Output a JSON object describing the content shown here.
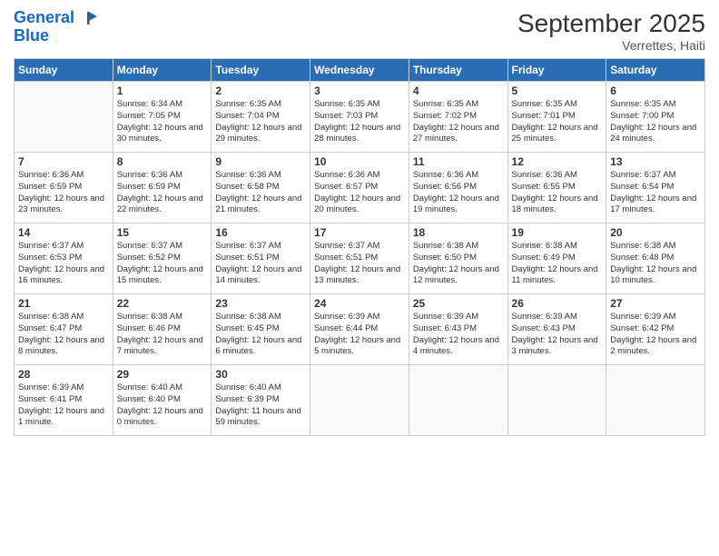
{
  "header": {
    "logo_line1": "General",
    "logo_line2": "Blue",
    "month_title": "September 2025",
    "subtitle": "Verrettes, Haiti"
  },
  "days_of_week": [
    "Sunday",
    "Monday",
    "Tuesday",
    "Wednesday",
    "Thursday",
    "Friday",
    "Saturday"
  ],
  "weeks": [
    [
      {
        "day": "",
        "empty": true
      },
      {
        "day": "1",
        "sunrise": "Sunrise: 6:34 AM",
        "sunset": "Sunset: 7:05 PM",
        "daylight": "Daylight: 12 hours and 30 minutes."
      },
      {
        "day": "2",
        "sunrise": "Sunrise: 6:35 AM",
        "sunset": "Sunset: 7:04 PM",
        "daylight": "Daylight: 12 hours and 29 minutes."
      },
      {
        "day": "3",
        "sunrise": "Sunrise: 6:35 AM",
        "sunset": "Sunset: 7:03 PM",
        "daylight": "Daylight: 12 hours and 28 minutes."
      },
      {
        "day": "4",
        "sunrise": "Sunrise: 6:35 AM",
        "sunset": "Sunset: 7:02 PM",
        "daylight": "Daylight: 12 hours and 27 minutes."
      },
      {
        "day": "5",
        "sunrise": "Sunrise: 6:35 AM",
        "sunset": "Sunset: 7:01 PM",
        "daylight": "Daylight: 12 hours and 25 minutes."
      },
      {
        "day": "6",
        "sunrise": "Sunrise: 6:35 AM",
        "sunset": "Sunset: 7:00 PM",
        "daylight": "Daylight: 12 hours and 24 minutes."
      }
    ],
    [
      {
        "day": "7",
        "sunrise": "Sunrise: 6:36 AM",
        "sunset": "Sunset: 6:59 PM",
        "daylight": "Daylight: 12 hours and 23 minutes."
      },
      {
        "day": "8",
        "sunrise": "Sunrise: 6:36 AM",
        "sunset": "Sunset: 6:59 PM",
        "daylight": "Daylight: 12 hours and 22 minutes."
      },
      {
        "day": "9",
        "sunrise": "Sunrise: 6:36 AM",
        "sunset": "Sunset: 6:58 PM",
        "daylight": "Daylight: 12 hours and 21 minutes."
      },
      {
        "day": "10",
        "sunrise": "Sunrise: 6:36 AM",
        "sunset": "Sunset: 6:57 PM",
        "daylight": "Daylight: 12 hours and 20 minutes."
      },
      {
        "day": "11",
        "sunrise": "Sunrise: 6:36 AM",
        "sunset": "Sunset: 6:56 PM",
        "daylight": "Daylight: 12 hours and 19 minutes."
      },
      {
        "day": "12",
        "sunrise": "Sunrise: 6:36 AM",
        "sunset": "Sunset: 6:55 PM",
        "daylight": "Daylight: 12 hours and 18 minutes."
      },
      {
        "day": "13",
        "sunrise": "Sunrise: 6:37 AM",
        "sunset": "Sunset: 6:54 PM",
        "daylight": "Daylight: 12 hours and 17 minutes."
      }
    ],
    [
      {
        "day": "14",
        "sunrise": "Sunrise: 6:37 AM",
        "sunset": "Sunset: 6:53 PM",
        "daylight": "Daylight: 12 hours and 16 minutes."
      },
      {
        "day": "15",
        "sunrise": "Sunrise: 6:37 AM",
        "sunset": "Sunset: 6:52 PM",
        "daylight": "Daylight: 12 hours and 15 minutes."
      },
      {
        "day": "16",
        "sunrise": "Sunrise: 6:37 AM",
        "sunset": "Sunset: 6:51 PM",
        "daylight": "Daylight: 12 hours and 14 minutes."
      },
      {
        "day": "17",
        "sunrise": "Sunrise: 6:37 AM",
        "sunset": "Sunset: 6:51 PM",
        "daylight": "Daylight: 12 hours and 13 minutes."
      },
      {
        "day": "18",
        "sunrise": "Sunrise: 6:38 AM",
        "sunset": "Sunset: 6:50 PM",
        "daylight": "Daylight: 12 hours and 12 minutes."
      },
      {
        "day": "19",
        "sunrise": "Sunrise: 6:38 AM",
        "sunset": "Sunset: 6:49 PM",
        "daylight": "Daylight: 12 hours and 11 minutes."
      },
      {
        "day": "20",
        "sunrise": "Sunrise: 6:38 AM",
        "sunset": "Sunset: 6:48 PM",
        "daylight": "Daylight: 12 hours and 10 minutes."
      }
    ],
    [
      {
        "day": "21",
        "sunrise": "Sunrise: 6:38 AM",
        "sunset": "Sunset: 6:47 PM",
        "daylight": "Daylight: 12 hours and 8 minutes."
      },
      {
        "day": "22",
        "sunrise": "Sunrise: 6:38 AM",
        "sunset": "Sunset: 6:46 PM",
        "daylight": "Daylight: 12 hours and 7 minutes."
      },
      {
        "day": "23",
        "sunrise": "Sunrise: 6:38 AM",
        "sunset": "Sunset: 6:45 PM",
        "daylight": "Daylight: 12 hours and 6 minutes."
      },
      {
        "day": "24",
        "sunrise": "Sunrise: 6:39 AM",
        "sunset": "Sunset: 6:44 PM",
        "daylight": "Daylight: 12 hours and 5 minutes."
      },
      {
        "day": "25",
        "sunrise": "Sunrise: 6:39 AM",
        "sunset": "Sunset: 6:43 PM",
        "daylight": "Daylight: 12 hours and 4 minutes."
      },
      {
        "day": "26",
        "sunrise": "Sunrise: 6:39 AM",
        "sunset": "Sunset: 6:43 PM",
        "daylight": "Daylight: 12 hours and 3 minutes."
      },
      {
        "day": "27",
        "sunrise": "Sunrise: 6:39 AM",
        "sunset": "Sunset: 6:42 PM",
        "daylight": "Daylight: 12 hours and 2 minutes."
      }
    ],
    [
      {
        "day": "28",
        "sunrise": "Sunrise: 6:39 AM",
        "sunset": "Sunset: 6:41 PM",
        "daylight": "Daylight: 12 hours and 1 minute."
      },
      {
        "day": "29",
        "sunrise": "Sunrise: 6:40 AM",
        "sunset": "Sunset: 6:40 PM",
        "daylight": "Daylight: 12 hours and 0 minutes."
      },
      {
        "day": "30",
        "sunrise": "Sunrise: 6:40 AM",
        "sunset": "Sunset: 6:39 PM",
        "daylight": "Daylight: 11 hours and 59 minutes."
      },
      {
        "day": "",
        "empty": true
      },
      {
        "day": "",
        "empty": true
      },
      {
        "day": "",
        "empty": true
      },
      {
        "day": "",
        "empty": true
      }
    ]
  ]
}
